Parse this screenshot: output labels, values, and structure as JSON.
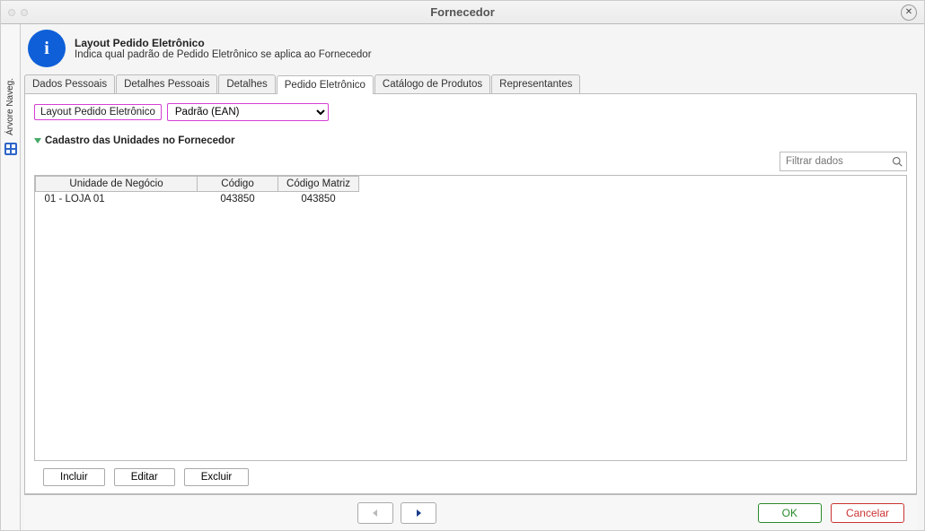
{
  "window": {
    "title": "Fornecedor"
  },
  "info": {
    "title": "Layout Pedido Eletrônico",
    "subtitle": "Indica qual padrão de Pedido Eletrônico se aplica ao Fornecedor"
  },
  "sidebar": {
    "tree_label": "Árvore Naveg."
  },
  "tabs": [
    {
      "label": "Dados Pessoais"
    },
    {
      "label": "Detalhes Pessoais"
    },
    {
      "label": "Detalhes"
    },
    {
      "label": "Pedido Eletrônico",
      "active": true
    },
    {
      "label": "Catálogo de Produtos"
    },
    {
      "label": "Representantes"
    }
  ],
  "layout_field": {
    "label": "Layout Pedido Eletrônico",
    "value": "Padrão (EAN)"
  },
  "section": {
    "title": "Cadastro das Unidades no Fornecedor"
  },
  "filter": {
    "placeholder": "Filtrar dados"
  },
  "table": {
    "headers": {
      "c1": "Unidade de Negócio",
      "c2": "Código",
      "c3": "Código Matriz"
    },
    "rows": [
      {
        "c1": "01 - LOJA 01",
        "c2": "043850",
        "c3": "043850"
      }
    ]
  },
  "grid_buttons": {
    "include": "Incluir",
    "edit": "Editar",
    "delete": "Excluir"
  },
  "footer": {
    "ok": "OK",
    "cancel": "Cancelar"
  }
}
